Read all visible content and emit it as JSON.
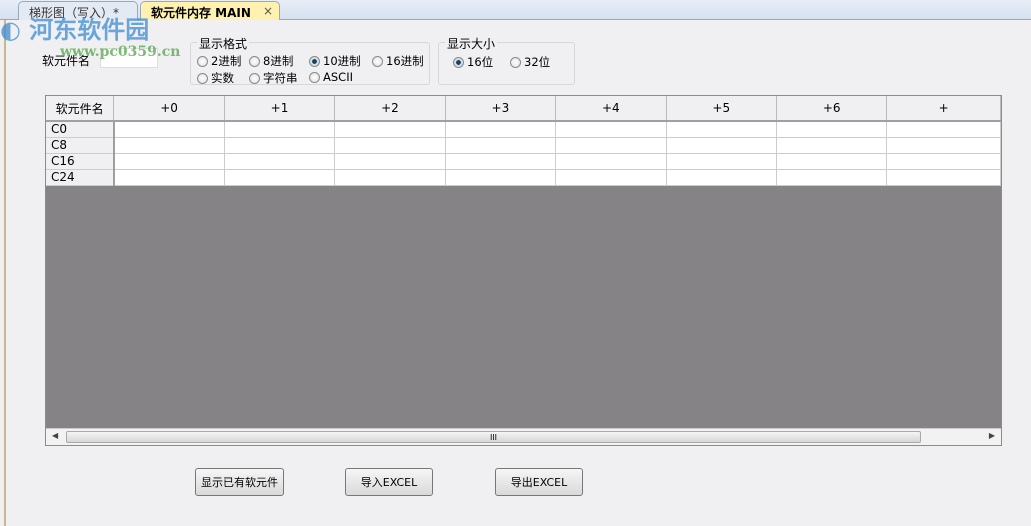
{
  "tabs": [
    {
      "label": "梯形图（写入）*"
    },
    {
      "label": "软元件内存 MAIN",
      "close": "×"
    }
  ],
  "device_name_label": "软元件名",
  "device_name_value": "",
  "format_group": {
    "title": "显示格式",
    "options": [
      "2进制",
      "8进制",
      "10进制",
      "16进制",
      "实数",
      "字符串",
      "ASCII"
    ],
    "selected": "10进制"
  },
  "size_group": {
    "title": "显示大小",
    "options": [
      "16位",
      "32位"
    ],
    "selected": "16位"
  },
  "table": {
    "header": [
      "软元件名",
      "+0",
      "+1",
      "+2",
      "+3",
      "+4",
      "+5",
      "+6",
      "+"
    ],
    "rows": [
      "C0",
      "C8",
      "C16",
      "C24"
    ]
  },
  "buttons": {
    "show": "显示已有软元件",
    "import": "导入EXCEL",
    "export": "导出EXCEL"
  },
  "watermark": {
    "name": "河东软件园",
    "url": "www.pc0359.cn"
  }
}
